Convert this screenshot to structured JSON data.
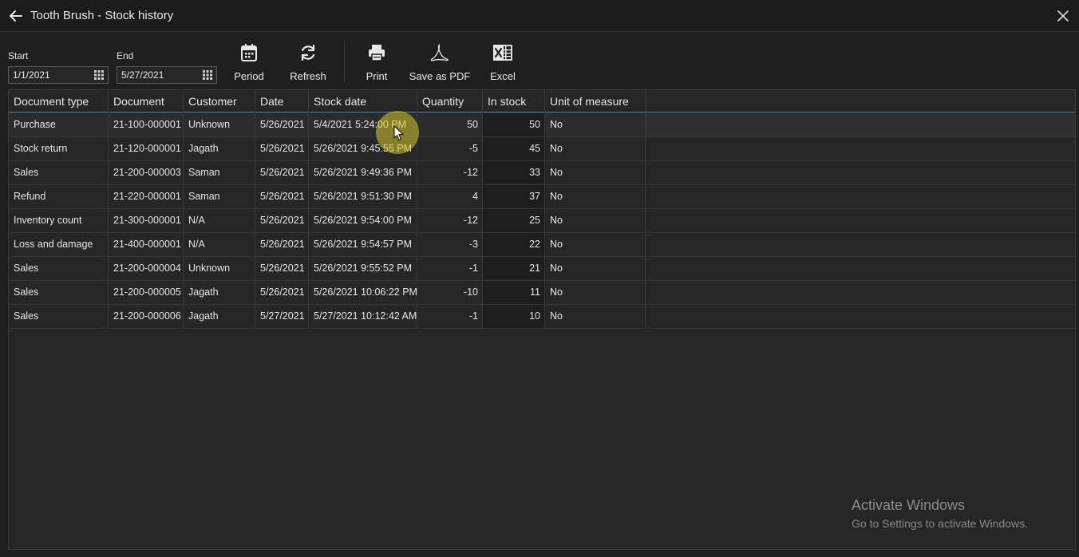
{
  "window": {
    "title": "Tooth Brush - Stock history"
  },
  "filters": {
    "start_label": "Start",
    "start_value": "1/1/2021",
    "end_label": "End",
    "end_value": "5/27/2021"
  },
  "toolbar": {
    "period_label": "Period",
    "refresh_label": "Refresh",
    "print_label": "Print",
    "save_pdf_label": "Save as PDF",
    "excel_label": "Excel"
  },
  "table": {
    "columns": [
      "Document type",
      "Document",
      "Customer",
      "Date",
      "Stock date",
      "Quantity",
      "In stock",
      "Unit of measure"
    ],
    "rows": [
      [
        "Purchase",
        "21-100-000001",
        "Unknown",
        "5/26/2021",
        "5/4/2021 5:24:00 PM",
        "50",
        "50",
        "No"
      ],
      [
        "Stock return",
        "21-120-000001",
        "Jagath",
        "5/26/2021",
        "5/26/2021 9:45:55 PM",
        "-5",
        "45",
        "No"
      ],
      [
        "Sales",
        "21-200-000003",
        "Saman",
        "5/26/2021",
        "5/26/2021 9:49:36 PM",
        "-12",
        "33",
        "No"
      ],
      [
        "Refund",
        "21-220-000001",
        "Saman",
        "5/26/2021",
        "5/26/2021 9:51:30 PM",
        "4",
        "37",
        "No"
      ],
      [
        "Inventory count",
        "21-300-000001",
        "N/A",
        "5/26/2021",
        "5/26/2021 9:54:00 PM",
        "-12",
        "25",
        "No"
      ],
      [
        "Loss and damage",
        "21-400-000001",
        "N/A",
        "5/26/2021",
        "5/26/2021 9:54:57 PM",
        "-3",
        "22",
        "No"
      ],
      [
        "Sales",
        "21-200-000004",
        "Unknown",
        "5/26/2021",
        "5/26/2021 9:55:52 PM",
        "-1",
        "21",
        "No"
      ],
      [
        "Sales",
        "21-200-000005",
        "Jagath",
        "5/26/2021",
        "5/26/2021 10:06:22 PM",
        "-10",
        "11",
        "No"
      ],
      [
        "Sales",
        "21-200-000006",
        "Jagath",
        "5/27/2021",
        "5/27/2021 10:12:42 AM",
        "-1",
        "10",
        "No"
      ]
    ]
  },
  "watermark": {
    "line1": "Activate Windows",
    "line2": "Go to Settings to activate Windows."
  },
  "colors": {
    "background": "#1f1f1f",
    "header_underline": "#4a86c5",
    "cursor_highlight": "#d6c828"
  },
  "icons": {
    "back": "arrow-left-icon",
    "close": "close-icon",
    "date_picker": "grid-icon",
    "period": "calendar-icon",
    "refresh": "refresh-icon",
    "print": "printer-icon",
    "save_pdf": "pdf-icon",
    "excel": "excel-icon"
  }
}
